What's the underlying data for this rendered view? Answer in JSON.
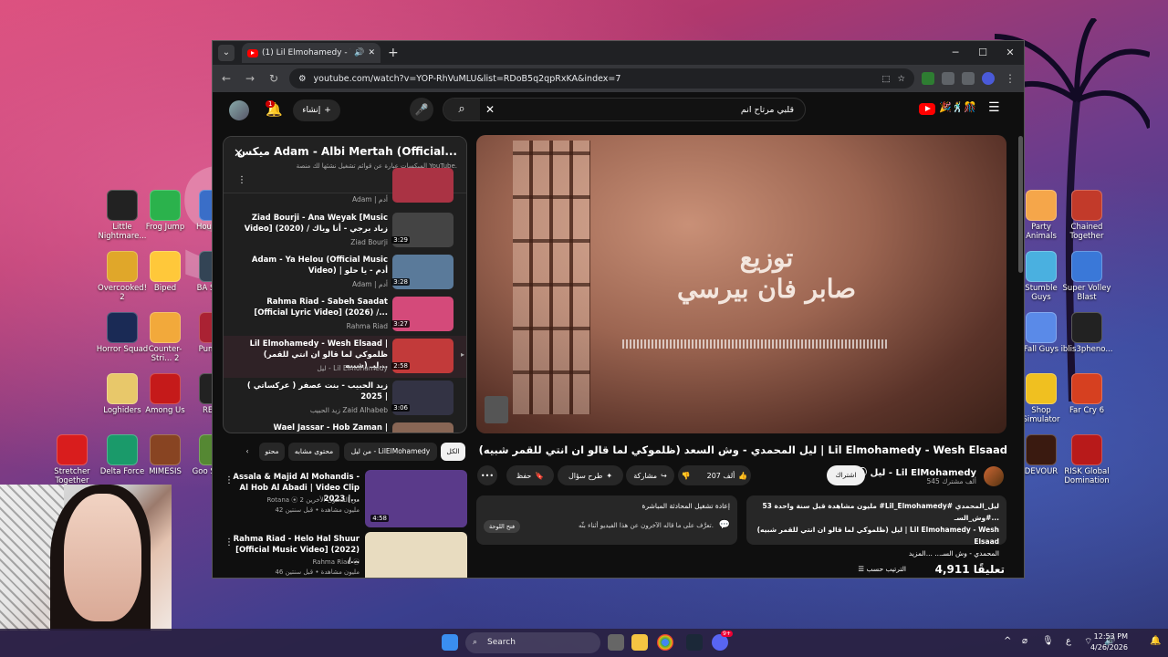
{
  "desktop": {
    "icons_left": [
      {
        "label": "Little Nightmare...",
        "color": "#222222"
      },
      {
        "label": "Frog Jump",
        "color": "#2bb24c"
      },
      {
        "label": "Hou Flipp",
        "color": "#3a6ec8"
      },
      {
        "label": "Overcooked! 2",
        "color": "#e0a72a"
      },
      {
        "label": "Biped",
        "color": "#ffc83a"
      },
      {
        "label": "BA SP PC",
        "color": "#334455"
      },
      {
        "label": "Horror Squad",
        "color": "#1a2a55"
      },
      {
        "label": "Counter-Stri... 2",
        "color": "#f2a93b"
      },
      {
        "label": "Pum Par",
        "color": "#aa2233"
      },
      {
        "label": "Loghiders",
        "color": "#e8c86a"
      },
      {
        "label": "Among Us",
        "color": "#c51a1a"
      },
      {
        "label": "REANI",
        "color": "#222222"
      },
      {
        "label": "Stretcher Together",
        "color": "#d91d1d"
      },
      {
        "label": "Delta Force",
        "color": "#1a9a6a"
      },
      {
        "label": "MIMESIS",
        "color": "#884422"
      },
      {
        "label": "Goo Simula",
        "color": "#558833"
      }
    ],
    "icons_right": [
      {
        "label": "Party Animals",
        "color": "#f5a64a"
      },
      {
        "label": "Chained Together",
        "color": "#c23a2a"
      },
      {
        "label": "Stumble Guys",
        "color": "#4ab0e0"
      },
      {
        "label": "Super Volley Blast",
        "color": "#3a78d8"
      },
      {
        "label": "Fall Guys",
        "color": "#5a8ae8"
      },
      {
        "label": "iblis3pheno...",
        "color": "#222222"
      },
      {
        "label": "Shop Simulator",
        "color": "#f0c020"
      },
      {
        "label": "Far Cry 6",
        "color": "#d64020"
      },
      {
        "label": "DEVOUR",
        "color": "#3a1a10"
      },
      {
        "label": "RISK Global Domination",
        "color": "#b81a1a"
      }
    ]
  },
  "browser": {
    "tab_title": "(1) Lil Elmohamedy - Wesh Elsaad",
    "tab_audio_icon": "speaker-icon",
    "new_tab": "+",
    "url": "youtube.com/watch?v=YOP-RhVuMLU&list=RDoB5q2qpRxKA&index=7",
    "ext_badge": "25"
  },
  "youtube": {
    "search_query": "قلبي مرتاح انم",
    "create_label": "إنشاء",
    "notif_count": "1",
    "playlist": {
      "title": "ميكس Adam - Albi Mertah (Official...",
      "subtitle": "الميكسات عبارة عن قوائم تشغيل نشئها لك منصة YouTube.",
      "items": [
        {
          "title": "Adam | أدم",
          "author": "",
          "duration": "",
          "thumb": "#aa3344",
          "partial": true
        },
        {
          "title": "Ziad Bourji - Ana Weyak [Music Video] (2020) / زياد برجي - أنا وياك",
          "author": "Ziad Bourji",
          "duration": "3:29",
          "thumb": "#444444"
        },
        {
          "title": "Adam - Ya Helou (Official Music Video) | أدم - يا حلو",
          "author": "Adam | أدم",
          "duration": "3:28",
          "thumb": "#5a7a9a"
        },
        {
          "title": "Rahma Riad - Sabeh Saadat [Official Lyric Video] (2026) /...",
          "author": "Rahma Riad",
          "duration": "3:27",
          "thumb": "#d44a7a"
        },
        {
          "title": "Lil Elmohamedy - Wesh Elsaad | (ظلموكي لما قالو ان انتي للقمر شبيه) ليـ...",
          "author": "ليل - Lil Elmohamedy",
          "duration": "2:58",
          "thumb": "#c23a3a",
          "selected": true
        },
        {
          "title": "زيد الحبيب - بنت عصفر ( عركساتي ) | 2025",
          "author": "زيد الحبيب Zaid Alhabeb",
          "duration": "3:06",
          "thumb": "#333344"
        },
        {
          "title": "Wael Jassar - Hob Zaman |",
          "author": "",
          "duration": "",
          "thumb": "#886655",
          "partial": true
        }
      ]
    },
    "player": {
      "caption_line1": "توزيع",
      "caption_line2": "صابر فان بيرسي"
    },
    "video": {
      "title": "ليل المحمدي - وش السعد (ظلموكي لما قالو ان انتي للقمر شبيه) | Lil Elmohamedy - Wesh Elsaad",
      "channel": "ليل - Lil ElMohamedy",
      "subscribers": "545 ألف مشترك",
      "subscribe_label": "اشتراك",
      "likes": "207 ألف",
      "share_label": "مشاركة",
      "ask_label": "طرح سؤال",
      "save_label": "حفظ",
      "more": "•••"
    },
    "description": {
      "meta": "53 مليون مشاهدة  قبل سنة واحدة  #Lil_Elmohamedy# ليل_المحمدي #وش_السـ...",
      "line2": "ليل (ظلموكي لما قالو ان انتي للقمر شبيه) | Lil Elmohamedy - Wesh Elsaad",
      "line3": "المحمدي - وش السـ... ...المزيد"
    },
    "chat": {
      "line1": "إعادة تشغيل المحادثة المباشرة",
      "line2": "تعرَّف على ما قاله الآخرون عن هذا الفيديو أثناء بثّه.",
      "open": "فتح اللوحة"
    },
    "comments": {
      "count": "4,911 تعليقًا",
      "sort": "الترتيب حسب"
    },
    "chips": [
      "الكل",
      "من ليل - LilElMohamedy",
      "محتوى مشابه",
      "محتو"
    ],
    "recommendations": [
      {
        "title": "Assala & Majid Al Mohandis - Al Hob Al Abadi | Video Clip 2023 |...",
        "author": "Rotana ⦿ 2 من المحتوى الأخرين",
        "views": "42 مليون مشاهدة • قبل سنتين",
        "duration": "4:58",
        "thumb": "#5a3a8a"
      },
      {
        "title": "Rahma Riad - Helo Hal Shuur [Official Music Video] (2022) /...",
        "author": "Rahma Riad ⦿",
        "views": "46 مليون مشاهدة • قبل سنتين",
        "duration": "",
        "thumb": "#e8dcc0"
      }
    ]
  },
  "taskbar": {
    "search_placeholder": "Search",
    "time": "12:53 PM",
    "date": "4/26/2026",
    "lang": "ع",
    "notif_badge": "9+"
  },
  "colors": {
    "yt_bg": "#0f0f0f",
    "yt_red": "#ff0000",
    "chip_active": "#f1f1f1"
  }
}
